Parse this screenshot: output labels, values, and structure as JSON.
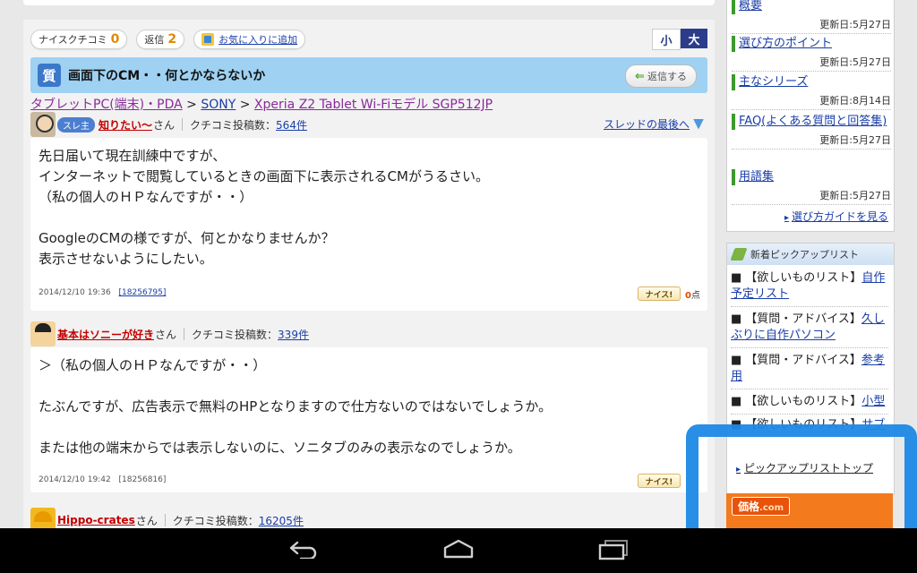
{
  "toolbar": {
    "nice_label": "ナイスクチコミ",
    "nice_count": "0",
    "reply_label": "返信",
    "reply_count": "2",
    "favorite_label": "お気に入りに追加",
    "font_small": "小",
    "font_large": "大"
  },
  "thread": {
    "q_icon": "質",
    "title": "画面下のCM・・何とかならないか",
    "reply_button": "返信する",
    "goto_end": "スレッドの最後へ"
  },
  "breadcrumb": {
    "cat": "タブレットPC(端末)・PDA",
    "maker": "SONY",
    "product": "Xperia Z2 Tablet Wi-Fiモデル SGP512JP",
    "sep": ">"
  },
  "common": {
    "san": "さん",
    "post_count_label": "クチコミ投稿数：",
    "nice_button": "ナイス!",
    "points_suffix": "点"
  },
  "posts": [
    {
      "badge": "スレ主",
      "author": "知りたい〜",
      "post_count": "564件",
      "body": "先日届いて現在訓練中ですが、\nインターネットで閲覧しているときの画面下に表示されるCMがうるさい。\n（私の個人のＨＰなんですが・・）\n\nGoogleのCMの様ですが、何とかなりませんか？\n表示させないようにしたい。",
      "datetime": "2014/12/10 19:36",
      "post_id": "[18256795]",
      "points": "0"
    },
    {
      "author": "基本はソニーが好き",
      "post_count": "339件",
      "body": "＞（私の個人のＨＰなんですが・・）\n\nたぶんですが、広告表示で無料のHPとなりますので仕方ないのではないでしょうか。\n\nまたは他の端末からでは表示しないのに、ソニタブのみの表示なのでしょうか。",
      "datetime": "2014/12/10 19:42",
      "post_id": "[18256816]"
    },
    {
      "author": "Hippo-crates",
      "post_count": "16205件"
    }
  ],
  "sidebar": {
    "guide": [
      {
        "label": "概要",
        "date": "更新日:5月27日"
      },
      {
        "label": "選び方のポイント",
        "date": "更新日:5月27日"
      },
      {
        "label": "主なシリーズ",
        "date": "更新日:8月14日"
      },
      {
        "label": "FAQ(よくある質問と回答集)",
        "date": "更新日:5月27日"
      },
      {
        "label": "用語集",
        "date": "更新日:5月27日"
      }
    ],
    "see_guide": "選び方ガイドを見る",
    "pick_title": "新着ピックアップリスト",
    "pick_items": [
      {
        "cat": "【欲しいものリスト】",
        "link": "自作予定リスト"
      },
      {
        "cat": "【質問・アドバイス】",
        "link": "久しぶりに自作パソコン"
      },
      {
        "cat": "【質問・アドバイス】",
        "link": "参考用"
      },
      {
        "cat": "【欲しいものリスト】",
        "link": "小型"
      },
      {
        "cat": "【欲しいものリスト】",
        "link": "サブ"
      }
    ],
    "pick_top": "ピックアップリストトップ",
    "kakaku_logo": "価格",
    "kakaku_com": ".com"
  },
  "colors": {
    "highlight": "#1e88e5",
    "title_bar": "#9fd1f2",
    "brand_navy": "#2b3d8a",
    "guide_accent": "#3c9a2e",
    "author_red": "#c40000"
  },
  "icons": [
    "question-icon",
    "reply-arrow-icon",
    "favorite-icon",
    "down-arrow-icon",
    "pencil-icon",
    "back-icon",
    "home-icon",
    "recent-apps-icon"
  ]
}
